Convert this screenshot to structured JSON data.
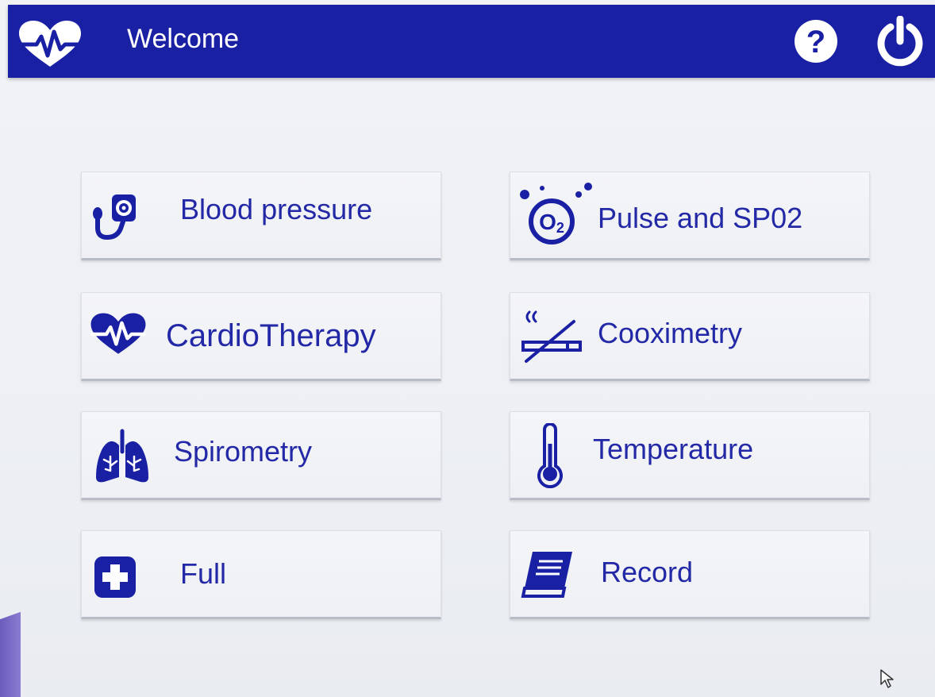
{
  "header": {
    "title": "Welcome",
    "logo_icon": "heart-pulse-icon",
    "help_icon": "question-circle-icon",
    "power_icon": "power-icon"
  },
  "menu": {
    "items": [
      {
        "label": "Blood pressure",
        "icon": "sphygmomanometer-icon"
      },
      {
        "label": "Pulse and SP02",
        "icon": "oxygen-o2-icon"
      },
      {
        "label": "CardioTherapy",
        "icon": "heart-pulse-icon"
      },
      {
        "label": "Cooximetry",
        "icon": "no-smoking-icon"
      },
      {
        "label": "Spirometry",
        "icon": "lungs-icon"
      },
      {
        "label": "Temperature",
        "icon": "thermometer-icon"
      },
      {
        "label": "Full",
        "icon": "medical-plus-icon"
      },
      {
        "label": "Record",
        "icon": "book-icon"
      }
    ]
  },
  "colors": {
    "header_bg": "#1a20a4",
    "accent": "#2329a6",
    "background": "#eef0f4"
  }
}
